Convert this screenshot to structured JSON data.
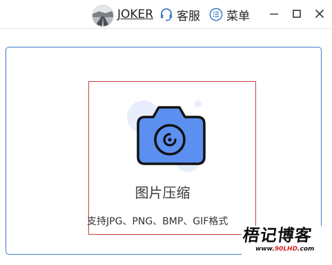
{
  "titlebar": {
    "username": "JOKER",
    "support_label": "客服",
    "menu_label": "菜单"
  },
  "tool": {
    "title": "图片压缩",
    "description": "支持JPG、PNG、BMP、GIF格式"
  },
  "watermark": {
    "name": "梧记博客",
    "url_pre": "www.",
    "url_highlight": "90LHD",
    "url_post": ".com"
  },
  "icons": {
    "avatar": "avatar-photo",
    "support": "headset-icon",
    "menu": "list-icon",
    "minimize": "minimize-icon",
    "maximize": "maximize-icon",
    "close": "close-icon",
    "illustration": "camera-icon"
  },
  "colors": {
    "accent_blue": "#3d79c5",
    "camera_fill": "#5b8ff0",
    "bubble": "#e7edfb",
    "drop_zone_border": "#c73b3b",
    "watermark_red": "#d42424"
  }
}
